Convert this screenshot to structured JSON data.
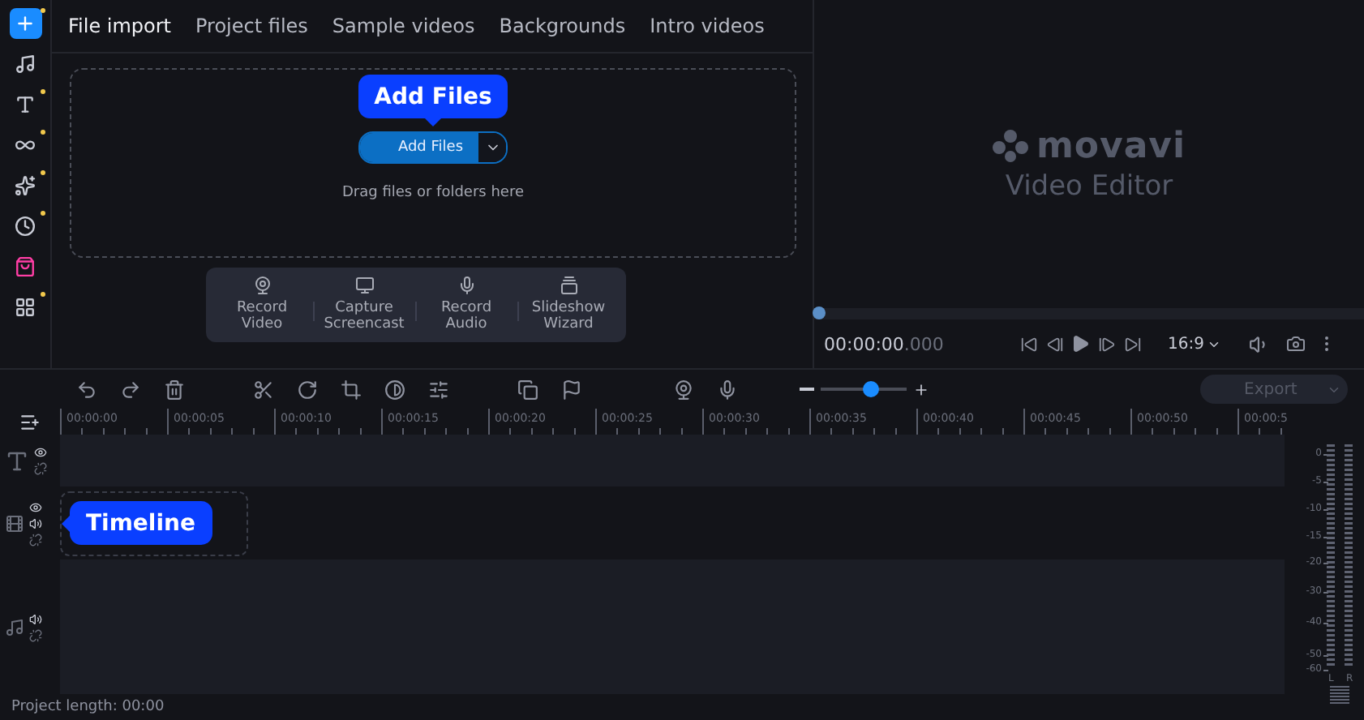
{
  "sidebar": {
    "items": [
      {
        "kind": "add",
        "selected": true,
        "badge": true
      },
      {
        "kind": "music",
        "selected": false,
        "badge": false
      },
      {
        "kind": "titles",
        "selected": false,
        "badge": true
      },
      {
        "kind": "transitions",
        "selected": false,
        "badge": true
      },
      {
        "kind": "effects",
        "selected": false,
        "badge": true
      },
      {
        "kind": "stickers",
        "selected": false,
        "badge": true
      },
      {
        "kind": "store",
        "selected": false,
        "badge": false
      },
      {
        "kind": "more",
        "selected": false,
        "badge": true
      }
    ]
  },
  "tabs": [
    {
      "label": "File import",
      "selected": true
    },
    {
      "label": "Project files",
      "selected": false
    },
    {
      "label": "Sample videos",
      "selected": false
    },
    {
      "label": "Backgrounds",
      "selected": false
    },
    {
      "label": "Intro videos",
      "selected": false
    }
  ],
  "import": {
    "callout": "Add Files",
    "button": "Add Files",
    "hint": "Drag files or folders here",
    "actions": [
      {
        "kind": "webcam",
        "label": "Record Video"
      },
      {
        "kind": "screen",
        "label": "Capture Screencast"
      },
      {
        "kind": "mic",
        "label": "Record Audio"
      },
      {
        "kind": "slideshow",
        "label": "Slideshow Wizard"
      }
    ]
  },
  "preview": {
    "logo": "movavi",
    "subtitle": "Video Editor",
    "level": 0,
    "time": "00:00:00",
    "time_ms": ".000",
    "aspect": "16:9"
  },
  "toolbar": {
    "zoom": {
      "level": 0.58
    },
    "export": {
      "label": "Export",
      "disabled": true
    }
  },
  "ruler": [
    "00:00:00",
    "00:00:05",
    "00:00:10",
    "00:00:15",
    "00:00:20",
    "00:00:25",
    "00:00:30",
    "00:00:35",
    "00:00:40",
    "00:00:45",
    "00:00:50",
    "00:00:5"
  ],
  "tracks": [
    {
      "kind": "text"
    },
    {
      "kind": "video"
    },
    {
      "kind": "audio"
    }
  ],
  "timeline_callout": "Timeline",
  "meter": {
    "scale": [
      "0",
      "-5",
      "-10",
      "-15",
      "-20",
      "-30",
      "-40",
      "-50",
      "-60"
    ],
    "channels": [
      "L",
      "R"
    ]
  },
  "status_bar": "Project length: 00:00"
}
